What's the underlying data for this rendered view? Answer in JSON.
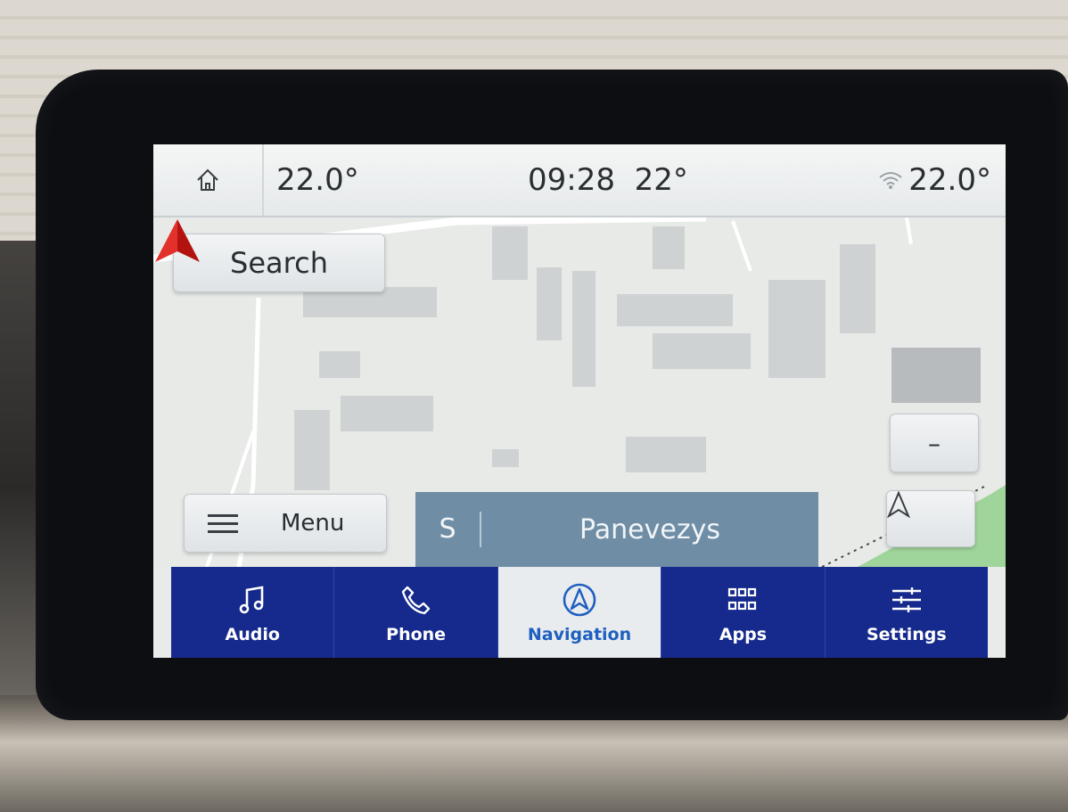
{
  "status_bar": {
    "temp_left": "22.0°",
    "clock": "09:28",
    "outside_temp": "22°",
    "temp_right": "22.0°"
  },
  "map": {
    "search_label": "Search",
    "menu_label": "Menu",
    "zoom_out_label": "–",
    "heading_direction": "S",
    "street_name": "Panevezys"
  },
  "tabs": [
    {
      "label": "Audio",
      "icon": "music-note-icon",
      "active": false
    },
    {
      "label": "Phone",
      "icon": "phone-icon",
      "active": false
    },
    {
      "label": "Navigation",
      "icon": "navigation-icon",
      "active": true
    },
    {
      "label": "Apps",
      "icon": "apps-grid-icon",
      "active": false
    },
    {
      "label": "Settings",
      "icon": "sliders-icon",
      "active": false
    }
  ],
  "colors": {
    "tabbar_bg": "#152a8c",
    "active_tab_text": "#1f5fbf",
    "street_bar_bg": "#6f8ea6",
    "vehicle_arrow": "#d6241f"
  }
}
